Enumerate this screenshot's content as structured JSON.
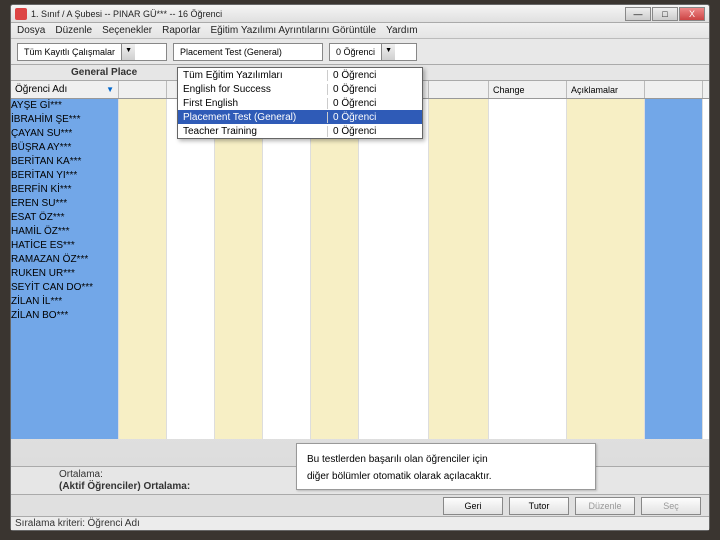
{
  "window": {
    "title": "1. Sınıf / A Şubesi -- PINAR GÜ*** -- 16 Öğrenci",
    "min": "—",
    "max": "□",
    "close": "X"
  },
  "menu": [
    "Dosya",
    "Düzenle",
    "Seçenekler",
    "Raporlar",
    "Eğitim Yazılımı Ayrıntılarını Görüntüle",
    "Yardım"
  ],
  "toolbar": {
    "combo1": "Tüm Kayıtlı Çalışmalar",
    "combo2": "Placement Test (General)",
    "combo3": "0 Öğrenci"
  },
  "subheader": "General Place",
  "columns": {
    "c0": "Öğrenci Adı",
    "c8": "Change",
    "c9": "Açıklamalar"
  },
  "dropdown": [
    {
      "l": "Tüm Eğitim Yazılımları",
      "r": "0 Öğrenci",
      "sel": false
    },
    {
      "l": "English for Success",
      "r": "0 Öğrenci",
      "sel": false
    },
    {
      "l": "First English",
      "r": "0 Öğrenci",
      "sel": false
    },
    {
      "l": "Placement Test (General)",
      "r": "0 Öğrenci",
      "sel": true
    },
    {
      "l": "Teacher Training",
      "r": "0 Öğrenci",
      "sel": false
    }
  ],
  "students": [
    "AYŞE Gİ***",
    "İBRAHİM ŞE***",
    "ÇAYAN SU***",
    "BÜŞRA AY***",
    "BERİTAN KA***",
    "BERİTAN YI***",
    "BERFİN Kİ***",
    "EREN SU***",
    "ESAT ÖZ***",
    "HAMİL ÖZ***",
    "HATİCE ES***",
    "RAMAZAN ÖZ***",
    "RUKEN UR***",
    "SEYİT CAN DO***",
    "ZİLAN İL***",
    "ZİLAN BO***"
  ],
  "avg": {
    "l1": "Ortalama:",
    "l2": "(Aktif Öğrenciler) Ortalama:"
  },
  "buttons": {
    "geri": "Geri",
    "tutor": "Tutor",
    "duzenle": "Düzenle",
    "sec": "Seç"
  },
  "status": {
    "label": "Sıralama kriteri:",
    "value": "Öğrenci Adı"
  },
  "note": {
    "line1": "Bu testlerden başarılı olan öğrenciler için",
    "line2": "diğer bölümler otomatik olarak açılacaktır."
  }
}
